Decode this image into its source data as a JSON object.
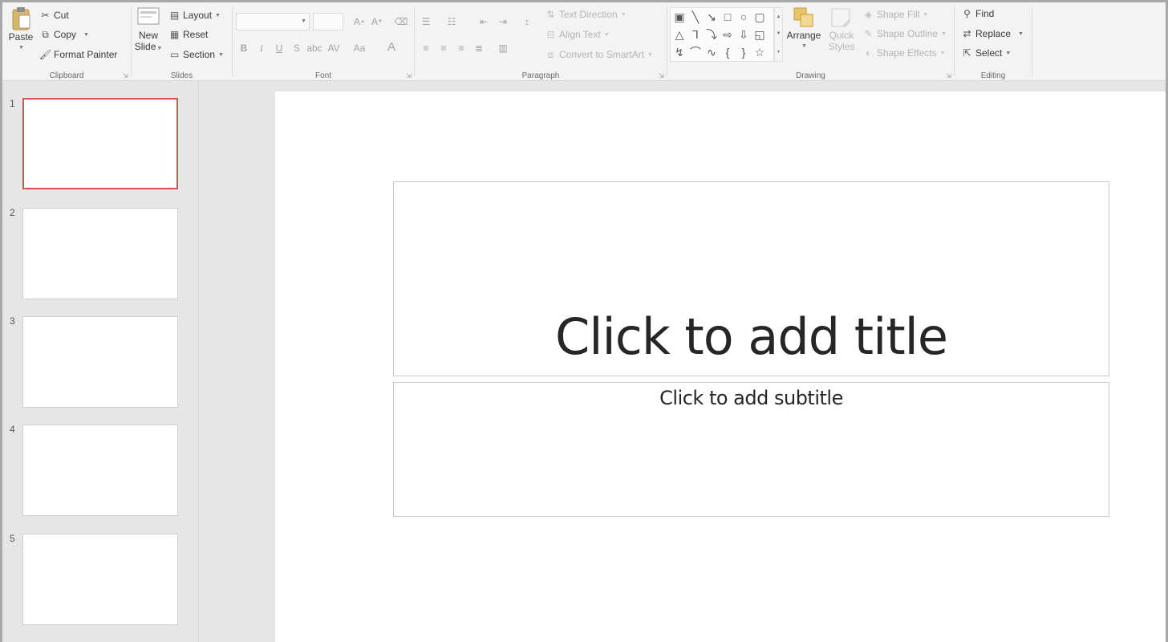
{
  "ribbon": {
    "clipboard": {
      "label": "Clipboard",
      "paste": "Paste",
      "cut": "Cut",
      "copy": "Copy",
      "format_painter": "Format Painter"
    },
    "slides": {
      "label": "Slides",
      "new_slide_line1": "New",
      "new_slide_line2": "Slide",
      "layout": "Layout",
      "reset": "Reset",
      "section": "Section"
    },
    "font": {
      "label": "Font",
      "font_name": "",
      "font_size": "",
      "bold": "B",
      "italic": "I",
      "underline": "U",
      "strikethrough": "S",
      "change_case": "Aa",
      "font_color": "A"
    },
    "paragraph": {
      "label": "Paragraph",
      "text_direction": "Text Direction",
      "align_text": "Align Text",
      "convert_smartart": "Convert to SmartArt"
    },
    "drawing": {
      "label": "Drawing",
      "arrange": "Arrange",
      "quick_styles_line1": "Quick",
      "quick_styles_line2": "Styles",
      "shape_fill": "Shape Fill",
      "shape_outline": "Shape Outline",
      "shape_effects": "Shape Effects"
    },
    "editing": {
      "label": "Editing",
      "find": "Find",
      "replace": "Replace",
      "select": "Select"
    }
  },
  "thumbnails": [
    {
      "number": "1",
      "selected": true
    },
    {
      "number": "2",
      "selected": false
    },
    {
      "number": "3",
      "selected": false
    },
    {
      "number": "4",
      "selected": false
    },
    {
      "number": "5",
      "selected": false
    }
  ],
  "slide": {
    "title_placeholder": "Click to add title",
    "subtitle_placeholder": "Click to add subtitle"
  },
  "colors": {
    "selected_thumb_border": "#c9594b",
    "ribbon_bg": "#f3f3f3",
    "workspace_bg": "#e6e6e6"
  }
}
